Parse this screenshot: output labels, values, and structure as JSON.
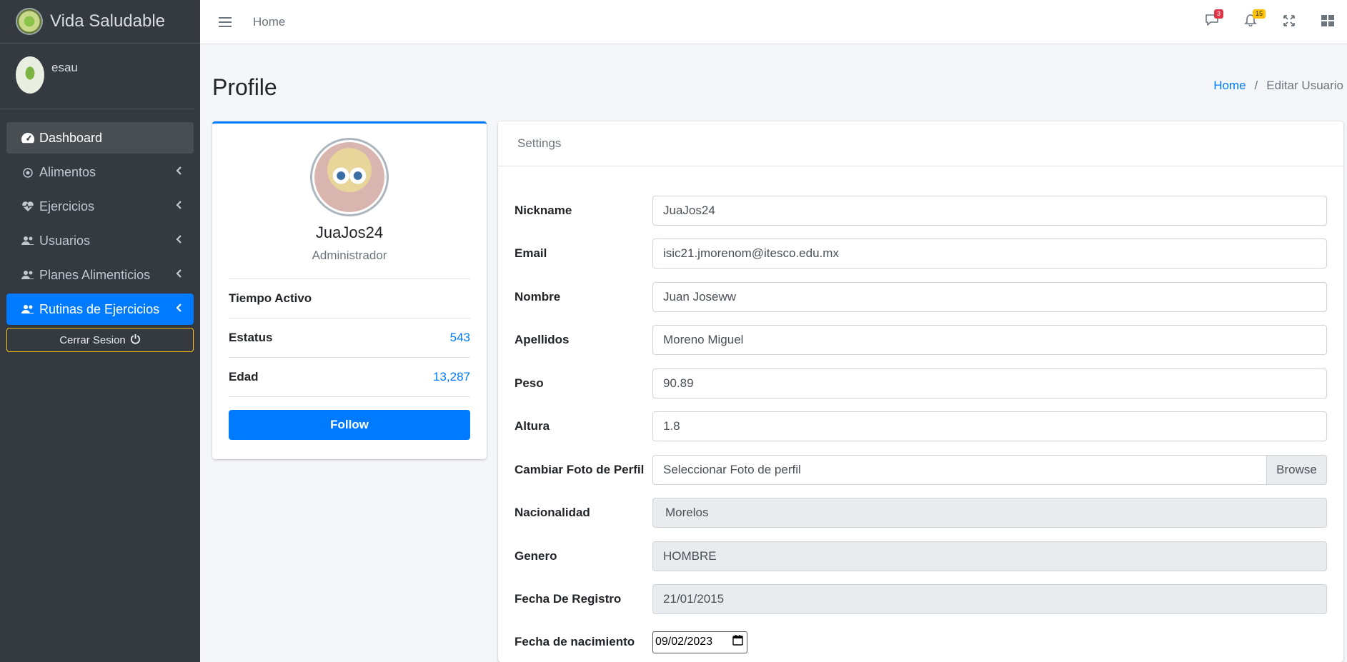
{
  "brand": {
    "title": "Vida Saludable"
  },
  "user": {
    "name": "esau"
  },
  "sidebar": {
    "items": [
      {
        "label": "Dashboard",
        "icon": "tachometer-icon",
        "state": "hover"
      },
      {
        "label": "Alimentos",
        "icon": "apple-icon"
      },
      {
        "label": "Ejercicios",
        "icon": "heartbeat-icon"
      },
      {
        "label": "Usuarios",
        "icon": "users-icon"
      },
      {
        "label": "Planes Alimenticios",
        "icon": "users-icon"
      },
      {
        "label": "Rutinas de Ejercicios",
        "icon": "users-icon",
        "state": "active"
      }
    ],
    "logout_label": "Cerrar Sesion"
  },
  "topbar": {
    "home_label": "Home",
    "messages_badge": "3",
    "notifications_badge": "15"
  },
  "page": {
    "title": "Profile",
    "breadcrumb": {
      "home": "Home",
      "current": "Editar Usuario"
    }
  },
  "profile": {
    "username": "JuaJos24",
    "role": "Administrador",
    "stats": [
      {
        "label": "Tiempo Activo",
        "value": ""
      },
      {
        "label": "Estatus",
        "value": "543"
      },
      {
        "label": "Edad",
        "value": "13,287"
      }
    ],
    "follow_label": "Follow"
  },
  "settings": {
    "header": "Settings",
    "fields": {
      "nickname": {
        "label": "Nickname",
        "value": "JuaJos24"
      },
      "email": {
        "label": "Email",
        "value": "isic21.jmorenom@itesco.edu.mx"
      },
      "nombre": {
        "label": "Nombre",
        "value": "Juan Joseww"
      },
      "apellidos": {
        "label": "Apellidos",
        "value": "Moreno Miguel"
      },
      "peso": {
        "label": "Peso",
        "value": "90.89"
      },
      "altura": {
        "label": "Altura",
        "value": "1.8"
      },
      "foto": {
        "label": "Cambiar Foto de Perfil",
        "placeholder": "Seleccionar Foto de perfil",
        "button": "Browse"
      },
      "nacionalidad": {
        "label": "Nacionalidad",
        "value": "Morelos"
      },
      "genero": {
        "label": "Genero",
        "value": "HOMBRE"
      },
      "fecha_registro": {
        "label": "Fecha De Registro",
        "value": "21/01/2015"
      },
      "fecha_nacimiento": {
        "label": "Fecha de nacimiento",
        "value": "09/02/2023"
      }
    }
  }
}
